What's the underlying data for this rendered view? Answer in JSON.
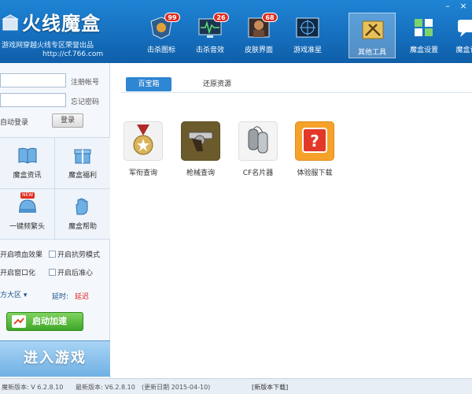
{
  "header": {
    "app_title": "火线魔盒",
    "subtitle": "游戏网穿越火线专区荣誉出品",
    "url": "http://cf.766.com"
  },
  "nav": [
    {
      "label": "击杀图标",
      "icon": "kill-icon",
      "badge": "99"
    },
    {
      "label": "击杀音效",
      "icon": "sound-monitor-icon",
      "badge": "26"
    },
    {
      "label": "皮肤界面",
      "icon": "skin-icon",
      "badge": "68"
    },
    {
      "label": "游戏准星",
      "icon": "crosshair-icon",
      "badge": ""
    },
    {
      "label": "其他工具",
      "icon": "tools-icon",
      "badge": ""
    },
    {
      "label": "魔盒设置",
      "icon": "settings-grid-icon",
      "badge": ""
    },
    {
      "label": "魔盒论",
      "icon": "forum-icon",
      "badge": ""
    }
  ],
  "login": {
    "register_link": "注册帐号",
    "forgot_link": "忘记密码",
    "auto_login": "自动登录",
    "login_button": "登录"
  },
  "tiles": [
    {
      "label": "魔盒资讯",
      "icon": "news-book-icon",
      "tag": ""
    },
    {
      "label": "魔盒福利",
      "icon": "gift-icon",
      "tag": ""
    },
    {
      "label": "一键频繁头",
      "icon": "helmet-icon",
      "tag": "NEW"
    },
    {
      "label": "魔盒帮助",
      "icon": "hand-help-icon",
      "tag": ""
    }
  ],
  "options": [
    {
      "label": "开启喷血效果"
    },
    {
      "label": "开启抗劳模式"
    },
    {
      "label": "开启窗口化"
    },
    {
      "label": "开启后准心"
    }
  ],
  "region": {
    "label": "方大区",
    "delay_label": "延时:",
    "delay_value": "延迟"
  },
  "boost_button": "启动加速",
  "enter_button": "进入游戏",
  "tabs": [
    {
      "label": "百宝箱",
      "active": true
    },
    {
      "label": "还原资源",
      "active": false
    }
  ],
  "tools": [
    {
      "label": "军衔查询",
      "icon": "medal-icon"
    },
    {
      "label": "枪械查询",
      "icon": "revolver-icon"
    },
    {
      "label": "CF名片器",
      "icon": "dog-tag-icon"
    },
    {
      "label": "体验服下载",
      "icon": "question-box-icon"
    }
  ],
  "status": {
    "current_version": "魔新版本: V 6.2.8.10",
    "latest_version": "最新版本: V6.2.8.10",
    "update_date": "(更新日期 2015-04-10)",
    "download_link": "[新版本下载]"
  }
}
